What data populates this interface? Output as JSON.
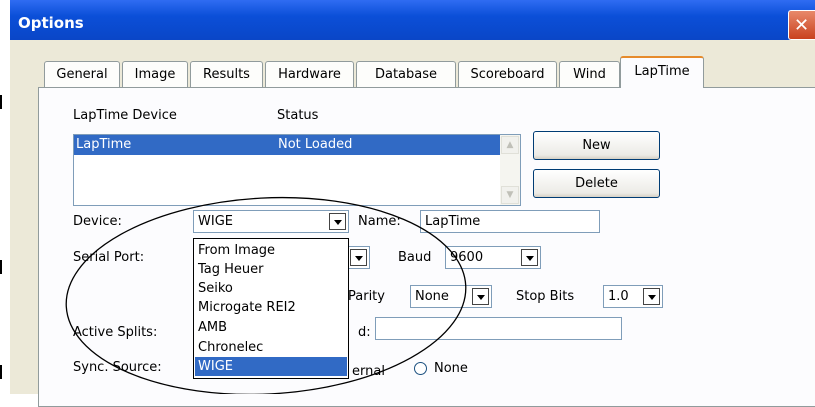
{
  "window": {
    "title": "Options"
  },
  "tabs": [
    {
      "label": "General"
    },
    {
      "label": "Image"
    },
    {
      "label": "Results"
    },
    {
      "label": "Hardware"
    },
    {
      "label": "Database"
    },
    {
      "label": "Scoreboard"
    },
    {
      "label": "Wind"
    },
    {
      "label": "LapTime",
      "active": true
    }
  ],
  "devices": {
    "col_device": "LapTime Device",
    "col_status": "Status",
    "rows": [
      {
        "device": "LapTime",
        "status": "Not Loaded",
        "selected": true
      }
    ]
  },
  "buttons": {
    "new_label": "New",
    "delete_label": "Delete"
  },
  "form": {
    "device_label": "Device:",
    "device_value": "WIGE",
    "name_label": "Name:",
    "name_value": "LapTime",
    "serial_port_label": "Serial Port:",
    "baud_label": "Baud",
    "baud_value": "9600",
    "parity_label": "Parity",
    "parity_value": "None",
    "stop_bits_label": "Stop Bits",
    "stop_bits_value": "1.0",
    "active_splits_label": "Active Splits:",
    "splits_partial_label": "d:",
    "splits_value": "",
    "sync_source_label": "Sync. Source:",
    "sync_partial_label": "ernal",
    "sync_none_label": "None"
  },
  "device_dropdown": {
    "options": [
      "From Image",
      "Tag Heuer",
      "Seiko",
      "Microgate REI2",
      "AMB",
      "Chronelec",
      "WIGE"
    ],
    "selected": "WIGE"
  },
  "colors": {
    "title_bar": "#0b4fd8",
    "selection": "#316ac5",
    "dialog_bg": "#ece9d8",
    "active_tab_accent": "#e68b2c",
    "close_button": "#c9411f"
  }
}
